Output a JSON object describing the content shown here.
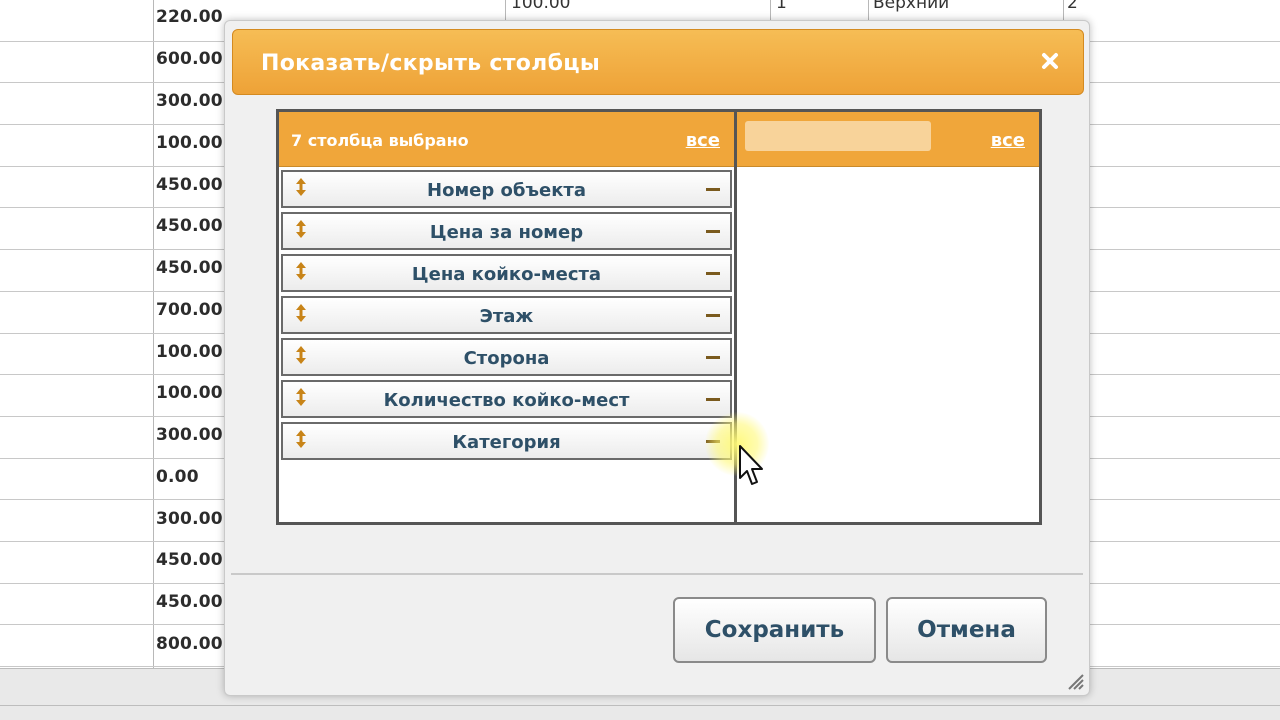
{
  "background": {
    "values": [
      "220.00",
      "600.00",
      "300.00",
      "100.00",
      "450.00",
      "450.00",
      "450.00",
      "700.00",
      "100.00",
      "100.00",
      "300.00",
      "0.00",
      "300.00",
      "450.00",
      "450.00",
      "800.00"
    ],
    "top_fragments": [
      "100.00",
      "1",
      "Верхний",
      "2"
    ]
  },
  "dialog": {
    "title": "Показать/скрыть столбцы",
    "close_icon": "close-x-icon"
  },
  "selected_column": {
    "count_text": "7 столбца выбрано",
    "all_link": "все",
    "items": [
      {
        "label": "Номер объекта"
      },
      {
        "label": "Цена за номер"
      },
      {
        "label": "Цена койко-места"
      },
      {
        "label": "Этаж"
      },
      {
        "label": "Сторона"
      },
      {
        "label": "Количество койко-мест"
      },
      {
        "label": "Категория"
      }
    ]
  },
  "available_column": {
    "search_value": "",
    "all_link": "все"
  },
  "buttons": {
    "save": "Сохранить",
    "cancel": "Отмена"
  },
  "colors": {
    "accent": "#F0A63A",
    "label_text": "#2E5068"
  }
}
